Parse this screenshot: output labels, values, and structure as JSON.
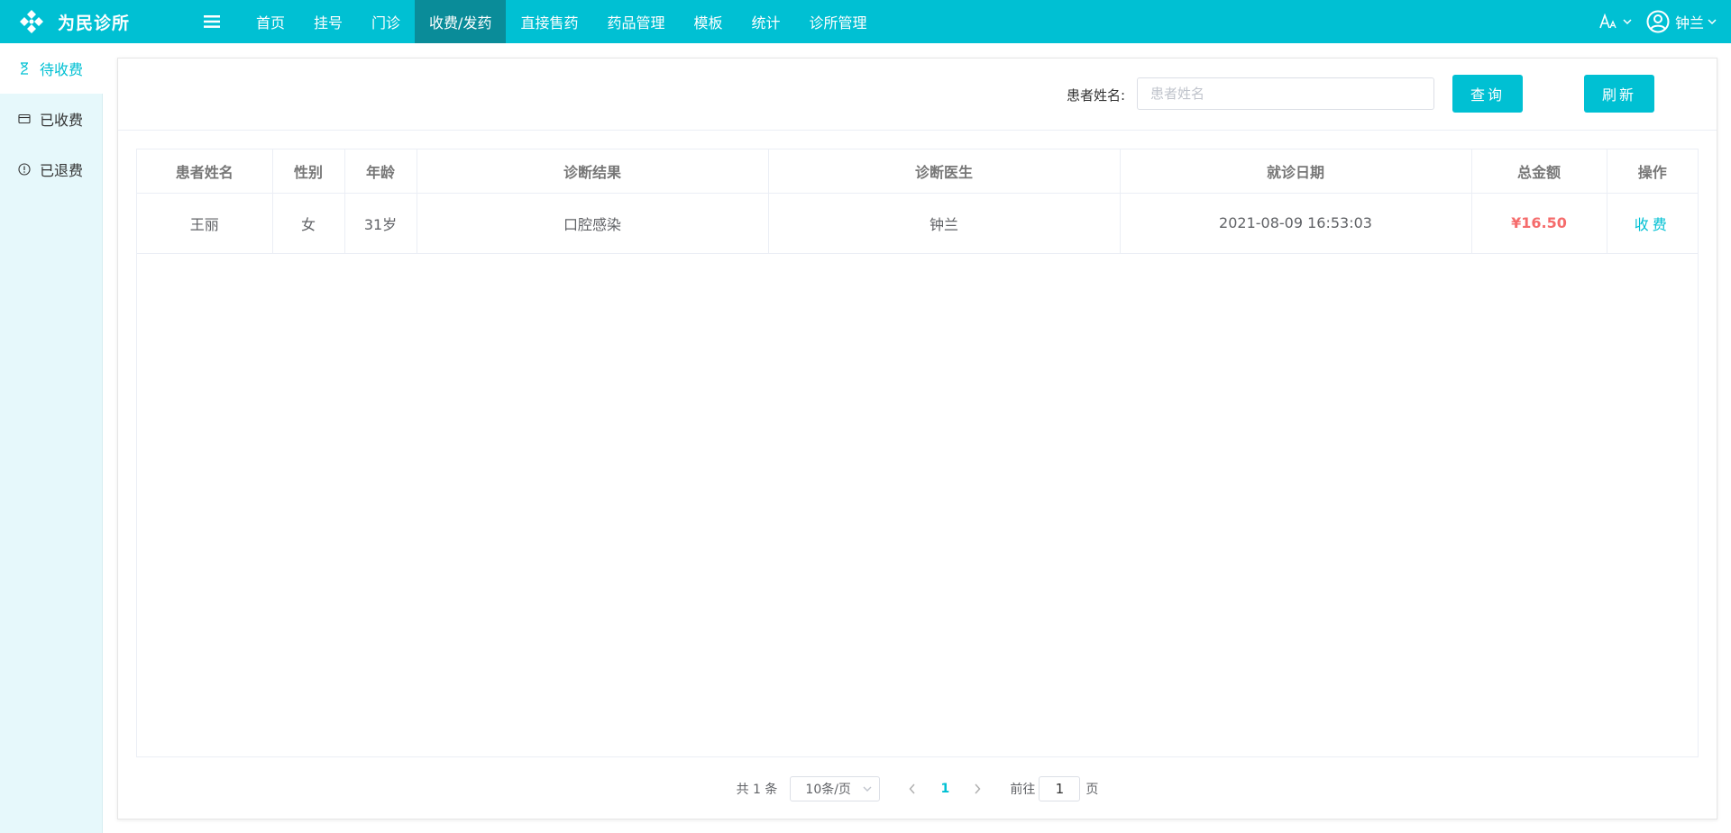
{
  "app": {
    "name": "为民诊所"
  },
  "nav": {
    "items": [
      {
        "label": "首页"
      },
      {
        "label": "挂号"
      },
      {
        "label": "门诊"
      },
      {
        "label": "收费/发药",
        "active": true
      },
      {
        "label": "直接售药"
      },
      {
        "label": "药品管理"
      },
      {
        "label": "模板"
      },
      {
        "label": "统计"
      },
      {
        "label": "诊所管理"
      }
    ]
  },
  "user": {
    "name": "钟兰"
  },
  "sidebar": {
    "items": [
      {
        "label": "待收费",
        "icon": "hourglass-icon",
        "active": true
      },
      {
        "label": "已收费",
        "icon": "card-icon"
      },
      {
        "label": "已退费",
        "icon": "info-circle-icon"
      }
    ]
  },
  "search": {
    "label": "患者姓名:",
    "placeholder": "患者姓名",
    "value": ""
  },
  "buttons": {
    "query": "查询",
    "refresh": "刷新"
  },
  "table": {
    "headers": [
      "患者姓名",
      "性别",
      "年龄",
      "诊断结果",
      "诊断医生",
      "就诊日期",
      "总金额",
      "操作"
    ],
    "rows": [
      {
        "name": "王丽",
        "gender": "女",
        "age": "31岁",
        "diagnosis": "口腔感染",
        "doctor": "钟兰",
        "date": "2021-08-09 16:53:03",
        "amount": "¥16.50",
        "action": "收费"
      }
    ]
  },
  "pagination": {
    "total": "共 1 条",
    "page_size": "10条/页",
    "current": "1",
    "goto_label": "前往",
    "goto_value": "1",
    "page_suffix": "页"
  },
  "colors": {
    "primary": "#00c0d3",
    "primary_dark": "#0a8c99",
    "sidebar_bg": "#e6f8fb",
    "amount": "#f56c6c"
  }
}
